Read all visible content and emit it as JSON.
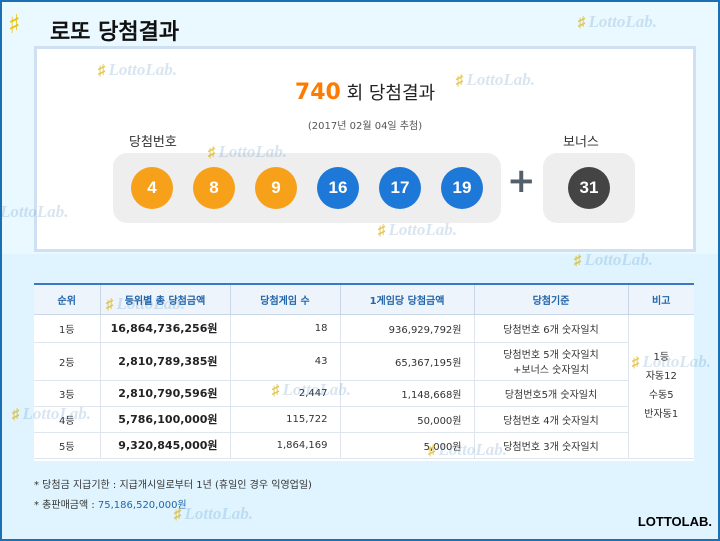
{
  "page": {
    "title": "로또 당첨결과",
    "title_icon": "hash-coin-icon",
    "brand": "LOTTOLAB."
  },
  "result": {
    "round_number": "740",
    "round_suffix": "회 당첨결과",
    "draw_date": "(2017년 02월 04일 추첨)",
    "winning_label": "당첨번호",
    "bonus_label": "보너스",
    "plus_symbol": "+",
    "numbers": [
      "4",
      "8",
      "9",
      "16",
      "17",
      "19"
    ],
    "bonus": "31",
    "ball_colors": {
      "orange": "#f7a01a",
      "blue": "#1e78d8",
      "dark": "#444444"
    }
  },
  "table": {
    "headers": [
      "순위",
      "등위별 총 당첨금액",
      "당첨게임 수",
      "1게임당 당첨금액",
      "당첨기준",
      "비고"
    ],
    "rows": [
      {
        "rank": "1등",
        "total": "16,864,736,256원",
        "games": "18",
        "per_game": "936,929,792원",
        "criteria1": "당첨번호 6개 숫자일치",
        "criteria2": ""
      },
      {
        "rank": "2등",
        "total": "2,810,789,385원",
        "games": "43",
        "per_game": "65,367,195원",
        "criteria1": "당첨번호 5개 숫자일치",
        "criteria2": "+보너스 숫자일치"
      },
      {
        "rank": "3등",
        "total": "2,810,790,596원",
        "games": "2,447",
        "per_game": "1,148,668원",
        "criteria1": "당첨번호5개 숫자일치",
        "criteria2": ""
      },
      {
        "rank": "4등",
        "total": "5,786,100,000원",
        "games": "115,722",
        "per_game": "50,000원",
        "criteria1": "당첨번호 4개 숫자일치",
        "criteria2": ""
      },
      {
        "rank": "5등",
        "total": "9,320,845,000원",
        "games": "1,864,169",
        "per_game": "5,000원",
        "criteria1": "당첨번호 3개 숫자일치",
        "criteria2": ""
      }
    ],
    "notes_col": [
      "1등",
      "자동12",
      "수동5",
      "반자동1"
    ]
  },
  "footer": {
    "note1": "* 당첨금 지급기한 : 지급개시일로부터 1년 (휴일인 경우 익영업일)",
    "note2_label": "* 총판매금액 : ",
    "note2_value": "75,186,520,000원"
  },
  "watermark": {
    "text": "LottoLab.",
    "icon": "hash-coin-icon"
  }
}
